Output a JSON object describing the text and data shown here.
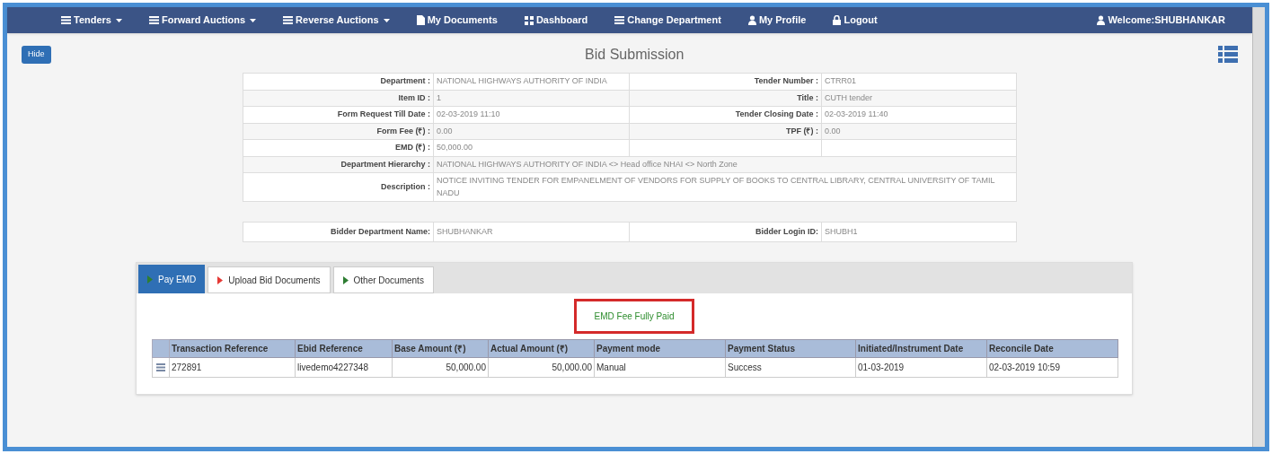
{
  "nav": {
    "items": [
      {
        "label": "Tenders",
        "kind": "grid",
        "dropdown": true
      },
      {
        "label": "Forward Auctions",
        "kind": "grid",
        "dropdown": true
      },
      {
        "label": "Reverse Auctions",
        "kind": "grid",
        "dropdown": true
      },
      {
        "label": "My Documents",
        "kind": "file",
        "dropdown": false
      },
      {
        "label": "Dashboard",
        "kind": "tiles",
        "dropdown": false
      },
      {
        "label": "Change Department",
        "kind": "grid",
        "dropdown": false
      },
      {
        "label": "My Profile",
        "kind": "user",
        "dropdown": false
      },
      {
        "label": "Logout",
        "kind": "lock",
        "dropdown": false
      }
    ],
    "welcome": "Welcome:SHUBHANKAR"
  },
  "hide_button": "Hide",
  "page_title": "Bid Submission",
  "tender_details": {
    "rows": [
      {
        "left_label": "Department :",
        "left_value": "NATIONAL HIGHWAYS AUTHORITY OF INDIA",
        "right_label": "Tender Number :",
        "right_value": "CTRR01"
      },
      {
        "left_label": "Item ID :",
        "left_value": "1",
        "right_label": "Title :",
        "right_value": "CUTH tender"
      },
      {
        "left_label": "Form Request Till Date :",
        "left_value": "02-03-2019 11:10",
        "right_label": "Tender Closing Date :",
        "right_value": "02-03-2019 11:40"
      },
      {
        "left_label": "Form Fee (₹) :",
        "left_value": "0.00",
        "right_label": "TPF (₹) :",
        "right_value": "0.00"
      },
      {
        "left_label": "EMD (₹) :",
        "left_value": "50,000.00"
      },
      {
        "left_label": "Department Hierarchy :",
        "left_value": "NATIONAL HIGHWAYS AUTHORITY OF INDIA <> Head office NHAI <> North Zone",
        "span": true
      },
      {
        "left_label": "Description :",
        "left_value": "NOTICE INVITING TENDER FOR EMPANELMENT OF VENDORS FOR SUPPLY OF BOOKS TO CENTRAL LIBRARY, CENTRAL UNIVERSITY OF TAMIL NADU",
        "span": true
      }
    ]
  },
  "bidder": {
    "left_label": "Bidder Department Name:",
    "left_value": "SHUBHANKAR",
    "right_label": "Bidder Login ID:",
    "right_value": "SHUBH1"
  },
  "tabs": [
    {
      "label": "Pay EMD",
      "selected": true,
      "color": "#2e7d32"
    },
    {
      "label": "Upload Bid Documents",
      "selected": false,
      "color": "#e53935"
    },
    {
      "label": "Other Documents",
      "selected": false,
      "color": "#2e7d32"
    }
  ],
  "status_message": "EMD Fee Fully Paid",
  "table": {
    "columns": [
      "Transaction Reference",
      "Ebid Reference",
      "Base Amount (₹)",
      "Actual Amount (₹)",
      "Payment mode",
      "Payment Status",
      "Initiated/Instrument Date",
      "Reconcile Date"
    ],
    "rows": [
      [
        "272891",
        "livedemo4227348",
        "50,000.00",
        "50,000.00",
        "Manual",
        "Success",
        "01-03-2019",
        "02-03-2019 10:59"
      ]
    ]
  }
}
